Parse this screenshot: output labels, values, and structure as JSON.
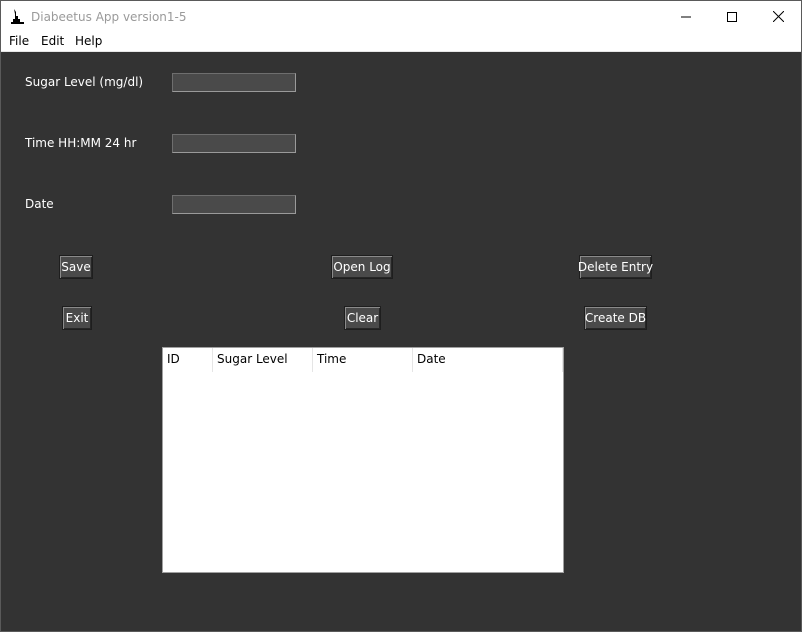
{
  "window": {
    "title": "Diabeetus App version1-5",
    "controls": {
      "minimize_icon": "minimize-icon",
      "maximize_icon": "maximize-icon",
      "close_icon": "close-icon"
    }
  },
  "menu": {
    "file": "File",
    "edit": "Edit",
    "help": "Help"
  },
  "form": {
    "sugar_label": "Sugar Level (mg/dl)",
    "sugar_value": "",
    "time_label": "Time HH:MM 24 hr",
    "time_value": "",
    "date_label": "Date",
    "date_value": ""
  },
  "buttons": {
    "save": "Save",
    "open_log": "Open Log",
    "delete_entry": "Delete Entry",
    "exit": "Exit",
    "clear": "Clear",
    "create_db": "Create DB"
  },
  "table": {
    "columns": [
      "ID",
      "Sugar Level",
      "Time",
      "Date"
    ],
    "rows": []
  },
  "colors": {
    "background": "#333333",
    "button": "#4a4a4a",
    "text": "#ffffff"
  }
}
